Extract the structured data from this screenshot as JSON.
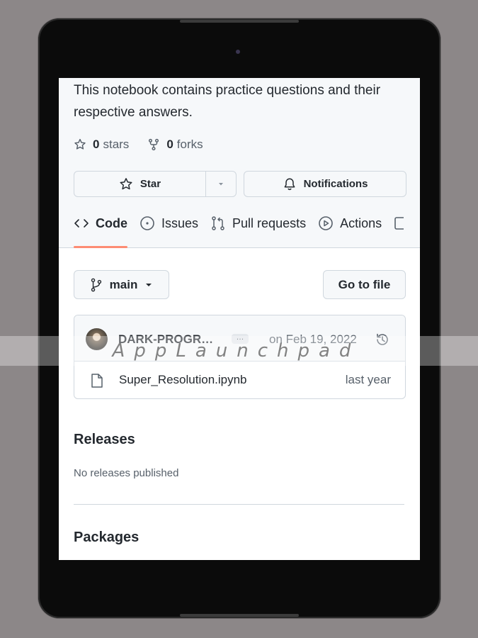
{
  "repo": {
    "description": "This notebook contains practice questions and their respective answers.",
    "stars_count": "0",
    "stars_label": "stars",
    "forks_count": "0",
    "forks_label": "forks"
  },
  "buttons": {
    "star_label": "Star",
    "notifications_label": "Notifications",
    "branch_label": "main",
    "goto_file_label": "Go to file"
  },
  "tabs": [
    {
      "label": "Code",
      "icon": "code-icon"
    },
    {
      "label": "Issues",
      "icon": "issue-icon"
    },
    {
      "label": "Pull requests",
      "icon": "pull-request-icon"
    },
    {
      "label": "Actions",
      "icon": "play-icon"
    }
  ],
  "commit": {
    "author": "DARK-PROGRAMMER",
    "ellipsis": "…",
    "date": "on Feb 19, 2022"
  },
  "files": [
    {
      "name": "Super_Resolution.ipynb",
      "updated": "last year"
    }
  ],
  "releases": {
    "heading": "Releases",
    "empty_text": "No releases published"
  },
  "packages": {
    "heading": "Packages"
  },
  "watermark": "AppLaunchpad",
  "colors": {
    "background": "#8c8788",
    "device": "#0b0b0b",
    "accent_underline": "#fd8c73",
    "border": "#d0d7de",
    "text": "#24292f",
    "muted": "#57606a"
  }
}
